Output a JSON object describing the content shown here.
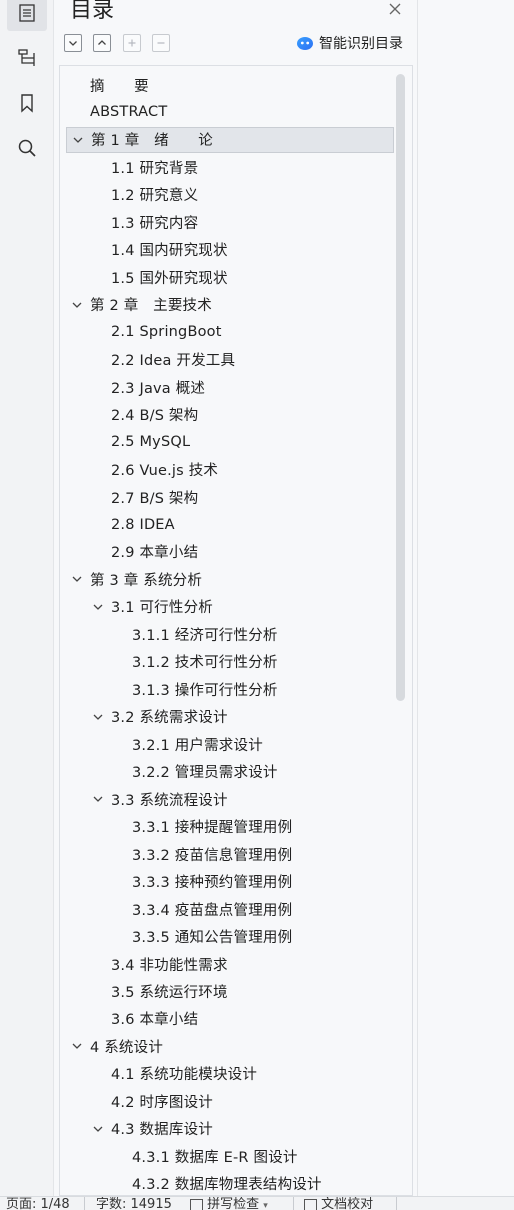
{
  "sidebar": {
    "icons": [
      "toc-icon",
      "outline-icon",
      "bookmark-icon",
      "search-icon"
    ]
  },
  "panel": {
    "title": "目录",
    "smart_label": "智能识别目录"
  },
  "toc": [
    {
      "label": "摘　　要",
      "level": 0,
      "expand": false
    },
    {
      "label": "ABSTRACT",
      "level": 0,
      "expand": false
    },
    {
      "label": "第 1 章　绪　　论",
      "level": 0,
      "expand": true,
      "selected": true
    },
    {
      "label": "1.1  研究背景",
      "level": 1,
      "expand": false
    },
    {
      "label": "1.2  研究意义",
      "level": 1,
      "expand": false
    },
    {
      "label": "1.3  研究内容",
      "level": 1,
      "expand": false
    },
    {
      "label": "1.4  国内研究现状",
      "level": 1,
      "expand": false
    },
    {
      "label": "1.5  国外研究现状",
      "level": 1,
      "expand": false
    },
    {
      "label": "第 2 章　主要技术",
      "level": 0,
      "expand": true
    },
    {
      "label": "2.1 SpringBoot",
      "level": 1,
      "expand": false
    },
    {
      "label": "2.2 Idea 开发工具",
      "level": 1,
      "expand": false
    },
    {
      "label": "2.3 Java 概述",
      "level": 1,
      "expand": false
    },
    {
      "label": "2.4 B/S 架构",
      "level": 1,
      "expand": false
    },
    {
      "label": "2.5 MySQL",
      "level": 1,
      "expand": false
    },
    {
      "label": "2.6 Vue.js 技术",
      "level": 1,
      "expand": false
    },
    {
      "label": "2.7 B/S 架构",
      "level": 1,
      "expand": false
    },
    {
      "label": "2.8 IDEA",
      "level": 1,
      "expand": false
    },
    {
      "label": "2.9  本章小结",
      "level": 1,
      "expand": false
    },
    {
      "label": "第 3 章  系统分析",
      "level": 0,
      "expand": true
    },
    {
      "label": "3.1  可行性分析",
      "level": 1,
      "expand": true
    },
    {
      "label": "3.1.1  经济可行性分析",
      "level": 2,
      "expand": false
    },
    {
      "label": "3.1.2  技术可行性分析",
      "level": 2,
      "expand": false
    },
    {
      "label": "3.1.3  操作可行性分析",
      "level": 2,
      "expand": false
    },
    {
      "label": "3.2 系统需求设计",
      "level": 1,
      "expand": true
    },
    {
      "label": "3.2.1  用户需求设计",
      "level": 2,
      "expand": false
    },
    {
      "label": "3.2.2  管理员需求设计",
      "level": 2,
      "expand": false
    },
    {
      "label": "3.3  系统流程设计",
      "level": 1,
      "expand": true
    },
    {
      "label": "3.3.1  接种提醒管理用例",
      "level": 2,
      "expand": false
    },
    {
      "label": "3.3.2  疫苗信息管理用例",
      "level": 2,
      "expand": false
    },
    {
      "label": "3.3.3  接种预约管理用例",
      "level": 2,
      "expand": false
    },
    {
      "label": "3.3.4  疫苗盘点管理用例",
      "level": 2,
      "expand": false
    },
    {
      "label": "3.3.5  通知公告管理用例",
      "level": 2,
      "expand": false
    },
    {
      "label": "3.4 非功能性需求",
      "level": 1,
      "expand": false
    },
    {
      "label": "3.5  系统运行环境",
      "level": 1,
      "expand": false
    },
    {
      "label": "3.6  本章小结",
      "level": 1,
      "expand": false
    },
    {
      "label": "4  系统设计",
      "level": 0,
      "expand": true
    },
    {
      "label": "4.1  系统功能模块设计",
      "level": 1,
      "expand": false
    },
    {
      "label": "4.2  时序图设计",
      "level": 1,
      "expand": false
    },
    {
      "label": "4.3  数据库设计",
      "level": 1,
      "expand": true
    },
    {
      "label": "4.3.1 数据库 E-R 图设计",
      "level": 2,
      "expand": false
    },
    {
      "label": "4.3.2 数据库物理表结构设计",
      "level": 2,
      "expand": false
    }
  ],
  "status": {
    "page": "页面: 1/48",
    "words": "字数: 14915",
    "spell": "拼写检查",
    "proof": "文档校对"
  }
}
